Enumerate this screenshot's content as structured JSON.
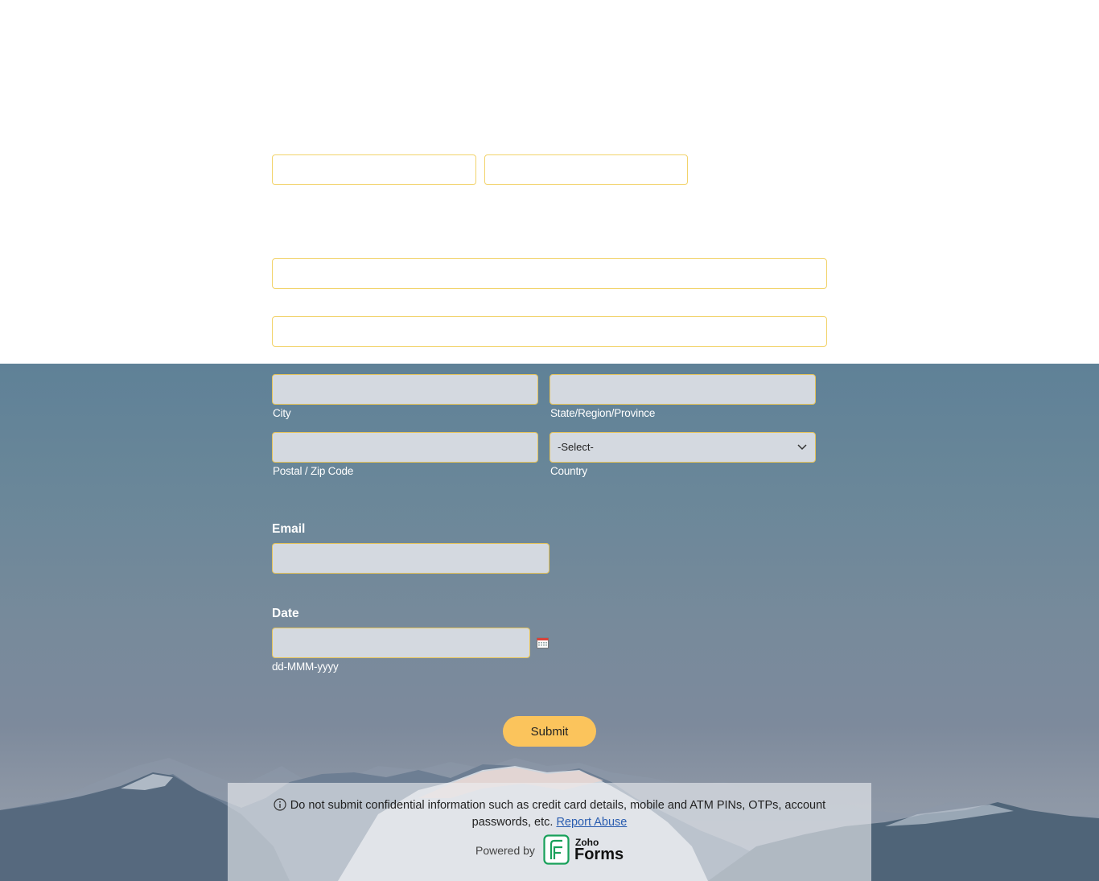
{
  "address": {
    "city_label": "City",
    "state_label": "State/Region/Province",
    "postal_label": "Postal / Zip Code",
    "country_label": "Country",
    "country_selected": "-Select-"
  },
  "email": {
    "label": "Email"
  },
  "date": {
    "label": "Date",
    "format_hint": "dd-MMM-yyyy"
  },
  "submit": {
    "label": "Submit"
  },
  "footer": {
    "notice_main": "Do not submit confidential information such as credit card details, mobile and ATM PINs, OTPs, account passwords, etc.",
    "report_link": "Report Abuse",
    "powered_by": "Powered by",
    "brand_small": "Zoho",
    "brand_big": "Forms"
  },
  "colors": {
    "field_border": "#f2d36b",
    "button": "#fbc45c",
    "background_sky": "#6a8799"
  },
  "icons": {
    "calendar": "calendar-icon",
    "info": "info-icon",
    "chevron": "chevron-down-icon",
    "logo": "zoho-forms-logo-icon"
  }
}
